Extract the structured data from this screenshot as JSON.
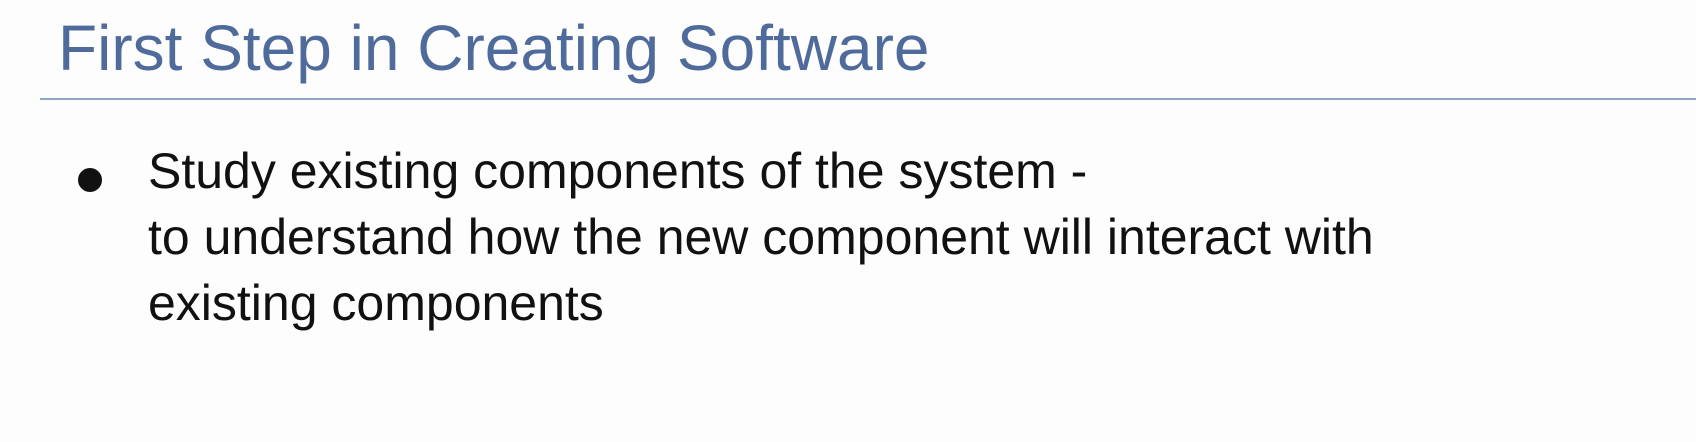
{
  "slide": {
    "title": "First Step in Creating Software",
    "bullets": [
      {
        "lines": [
          "Study existing components of the system -",
          "to understand how the new component will interact with",
          "existing components"
        ]
      }
    ]
  },
  "colors": {
    "title": "#4f6b9c",
    "divider": "#8fa8c8",
    "text": "#111111",
    "background": "#fdfdfd"
  }
}
